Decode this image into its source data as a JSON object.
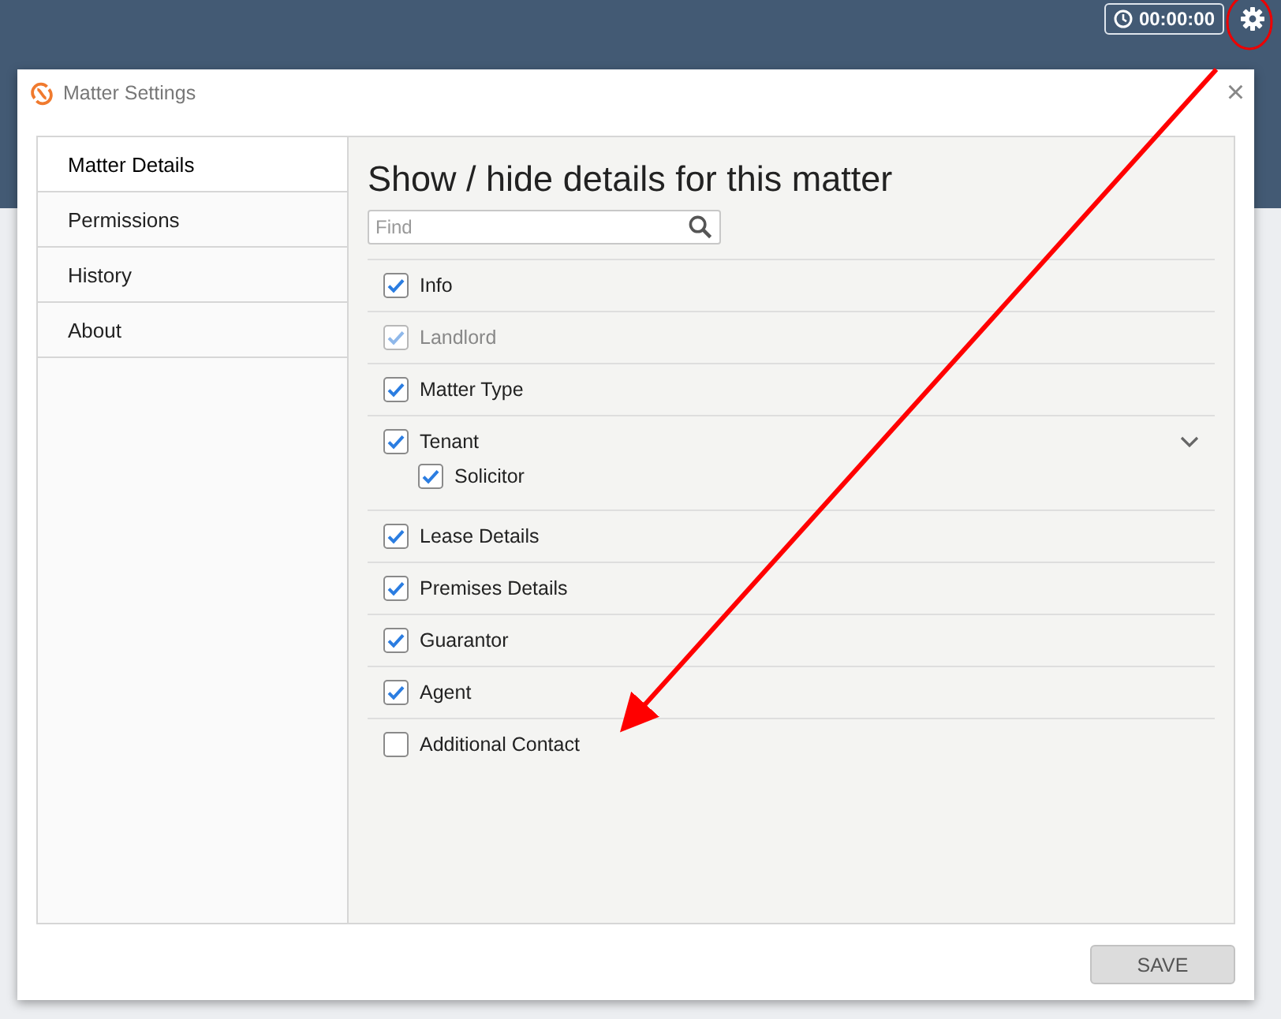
{
  "header": {
    "timer": "00:00:00"
  },
  "dialog": {
    "title": "Matter Settings",
    "close": "×",
    "sidebar": {
      "items": [
        {
          "label": "Matter Details",
          "selected": true
        },
        {
          "label": "Permissions",
          "selected": false
        },
        {
          "label": "History",
          "selected": false
        },
        {
          "label": "About",
          "selected": false
        }
      ]
    },
    "heading": "Show / hide details for this matter",
    "search": {
      "placeholder": "Find"
    },
    "options": [
      {
        "label": "Info",
        "checked": true,
        "disabled": false
      },
      {
        "label": "Landlord",
        "checked": true,
        "disabled": true
      },
      {
        "label": "Matter Type",
        "checked": true,
        "disabled": false
      },
      {
        "label": "Tenant",
        "checked": true,
        "disabled": false,
        "expanded": true,
        "children": [
          {
            "label": "Solicitor",
            "checked": true,
            "disabled": false
          }
        ]
      },
      {
        "label": "Lease Details",
        "checked": true,
        "disabled": false
      },
      {
        "label": "Premises Details",
        "checked": true,
        "disabled": false
      },
      {
        "label": "Guarantor",
        "checked": true,
        "disabled": false
      },
      {
        "label": "Agent",
        "checked": true,
        "disabled": false
      },
      {
        "label": "Additional Contact",
        "checked": false,
        "disabled": false
      }
    ],
    "buttons": [
      {
        "label": "SAVE"
      }
    ]
  }
}
